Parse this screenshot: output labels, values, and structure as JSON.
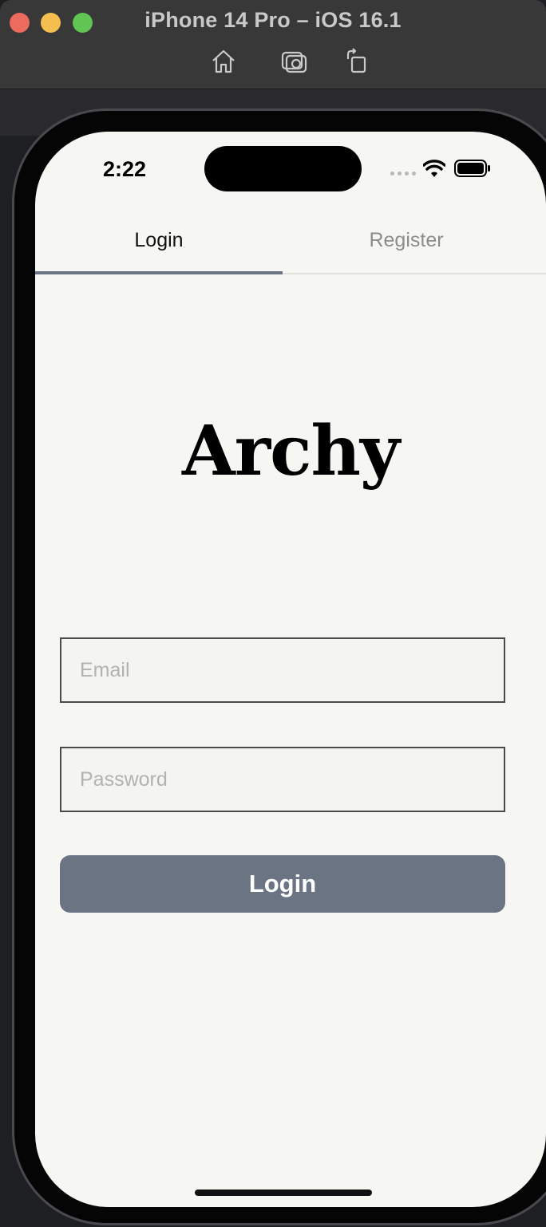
{
  "window": {
    "title": "iPhone 14 Pro – iOS 16.1",
    "toolbar": [
      "home-icon",
      "screenshot-icon",
      "rotate-icon"
    ]
  },
  "status_bar": {
    "time": "2:22",
    "icons": [
      "signal-icon",
      "wifi-icon",
      "battery-icon"
    ]
  },
  "tabs": [
    {
      "label": "Login",
      "selected": true
    },
    {
      "label": "Register",
      "selected": false
    }
  ],
  "logo": {
    "text": "Archy"
  },
  "form": {
    "email_placeholder": "Email",
    "password_placeholder": "Password",
    "submit_label": "Login"
  },
  "colors": {
    "accent": "#6a7483",
    "screen_background": "#f6f6f2",
    "tab_inactive": "#8c8c8c"
  }
}
